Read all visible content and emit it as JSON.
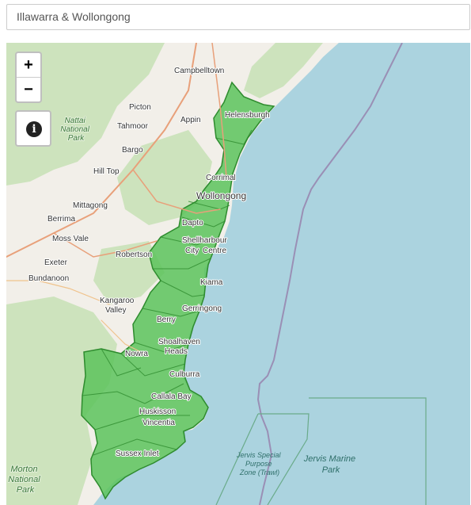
{
  "search": {
    "value": "Illawarra & Wollongong"
  },
  "controls": {
    "zoom_in": "+",
    "zoom_out": "−",
    "info_icon": "i"
  },
  "colors": {
    "sea": "#abd3df",
    "land": "#f2efe9",
    "park": "#cde3bd",
    "region": "#5cc35c",
    "region_border": "#2e8b2e"
  },
  "places": {
    "campbelltown": "Campbelltown",
    "picton": "Picton",
    "appin": "Appin",
    "tahmoor": "Tahmoor",
    "bargo": "Bargo",
    "hill_top": "Hill Top",
    "mittagong": "Mittagong",
    "berrima": "Berrima",
    "moss_vale": "Moss Vale",
    "exeter": "Exeter",
    "bundanoon": "Bundanoon",
    "robertson": "Robertson",
    "kangaroo_valley": [
      "Kangaroo",
      "Valley"
    ],
    "helensburgh": "Helensburgh",
    "corrimal": "Corrimal",
    "wollongong": "Wollongong",
    "dapto": "Dapto",
    "shellharbour": "Shellharbour",
    "city_centre": [
      "City",
      "Centre"
    ],
    "kiama": "Kiama",
    "gerringong": "Gerringong",
    "berry": "Berry",
    "shoalhaven_heads": [
      "Shoalhaven",
      "Heads"
    ],
    "nowra": "Nowra",
    "culburra": "Culburra",
    "callala_bay": "Callala Bay",
    "huskisson": "Huskisson",
    "vincentia": "Vincentia",
    "sussex_inlet": "Sussex Inlet",
    "nattai_np": [
      "Nattai",
      "National",
      "Park"
    ],
    "morton_np": [
      "Morton",
      "National",
      "Park"
    ],
    "jervis_special": [
      "Jervis Special",
      "Purpose",
      "Zone (Trawl)"
    ],
    "jervis_marine": [
      "Jervis Marine",
      "Park"
    ]
  }
}
